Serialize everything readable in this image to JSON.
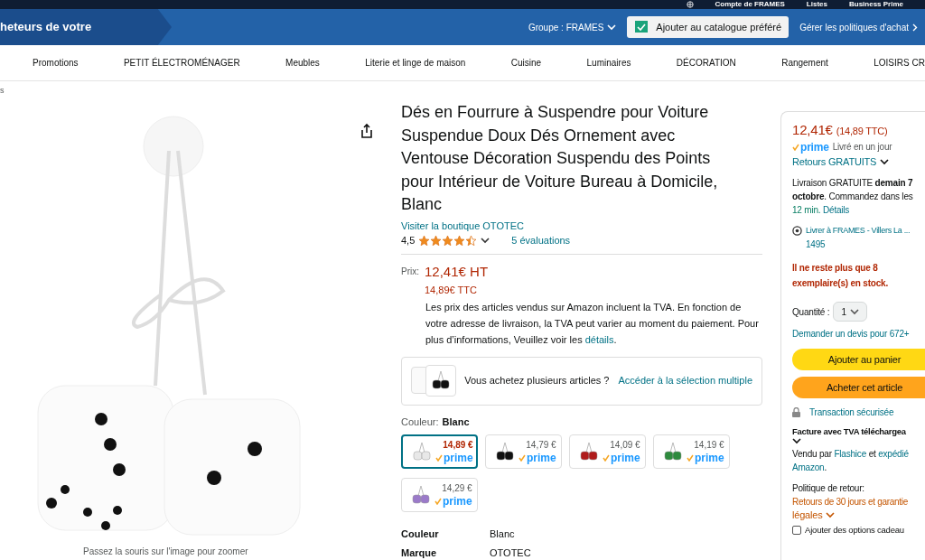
{
  "top_bar": {
    "account": "Compte de FRAMES",
    "lists": "Listes",
    "business": "Business Prime"
  },
  "header": {
    "banner": "heteurs de votre",
    "group": "Groupe : FRAMES",
    "catalog_button": "Ajouter au catalogue préféré",
    "policies": "Gérer les politiques d'achat"
  },
  "nav": [
    "Promotions",
    "PETIT ÉLECTROMÉNAGER",
    "Meubles",
    "Literie et linge de maison",
    "Cuisine",
    "Luminaires",
    "DÉCORATION",
    "Rangement",
    "LOISIRS CR"
  ],
  "breadcrumb": "s",
  "image_caption": "Passez la souris sur l'image pour zoomer",
  "product": {
    "title": "Dés en Fourrure à Suspendre pour Voiture Suspendue Doux Dés Ornement avec Ventouse Décoration Suspendu des Points pour Intérieur de Voiture Bureau à Domicile, Blanc",
    "store_link": "Visiter la boutique OTOTEC",
    "rating": "4,5",
    "stars": 4.5,
    "reviews": "5 évaluations",
    "price_label": "Prix:",
    "price_ht": "12,41€ HT",
    "price_ttc": "14,89€ TTC",
    "vat_note": "Les prix des articles vendus sur Amazon incluent la TVA. En fonction de votre adresse de livraison, la TVA peut varier au moment du paiement. Pour plus d’informations, Veuillez voir les",
    "vat_link": "détails",
    "vat_end": ".",
    "multi_text": "Vous achetez plusieurs articles ?",
    "multi_link": "Accéder à la sélection multiple",
    "color_label": "Couleur:",
    "color_value": "Blanc",
    "variants": [
      {
        "price": "14,89 €",
        "prime": "prime",
        "selected": true,
        "color": "#e8e8e8"
      },
      {
        "price": "14,79 €",
        "prime": "prime",
        "selected": false,
        "color": "#111111"
      },
      {
        "price": "14,09 €",
        "prime": "prime",
        "selected": false,
        "color": "#b01c1c"
      },
      {
        "price": "14,19 €",
        "prime": "prime",
        "selected": false,
        "color": "#2e8b3e"
      },
      {
        "price": "14,29 €",
        "prime": "prime",
        "selected": false,
        "color": "#9b7ac9"
      }
    ],
    "specs": [
      {
        "label": "Couleur",
        "value": "Blanc"
      },
      {
        "label": "Marque",
        "value": "OTOTEC"
      }
    ]
  },
  "buybox": {
    "price": "12,41€",
    "price_ttc": "(14,89 TTC)",
    "prime": "prime",
    "delivery_speed": "Livré en un jour",
    "returns": "Retours GRATUITS",
    "delivery": "Livraison GRATUITE **demain 7 octobre**. Commandez dans les",
    "countdown": "12 min.",
    "details": "Détails",
    "location": "Livrer à FRAMES - Villers La ...",
    "location_code": "1495",
    "stock": "Il ne reste plus que 8 exemplaire(s) en stock.",
    "qty_label": "Quantité :",
    "qty": "1",
    "quote": "Demander un devis pour 672+",
    "add_cart": "Ajouter au panier",
    "buy_now": "Acheter cet article",
    "secure": "Transaction sécurisée",
    "invoice": "Facture avec TVA téléchargea",
    "sold_by": "Vendu par",
    "seller": "Flashice",
    "and": "et",
    "shipped": "expédié",
    "shipper": "Amazon",
    "shipper_end": ".",
    "return_label": "Politique de retour:",
    "return_policy": "Retours de 30 jours et garantie",
    "return_policy_2": "légales",
    "gift": "Ajouter des options cadeau",
    "gift_checked": false
  }
}
